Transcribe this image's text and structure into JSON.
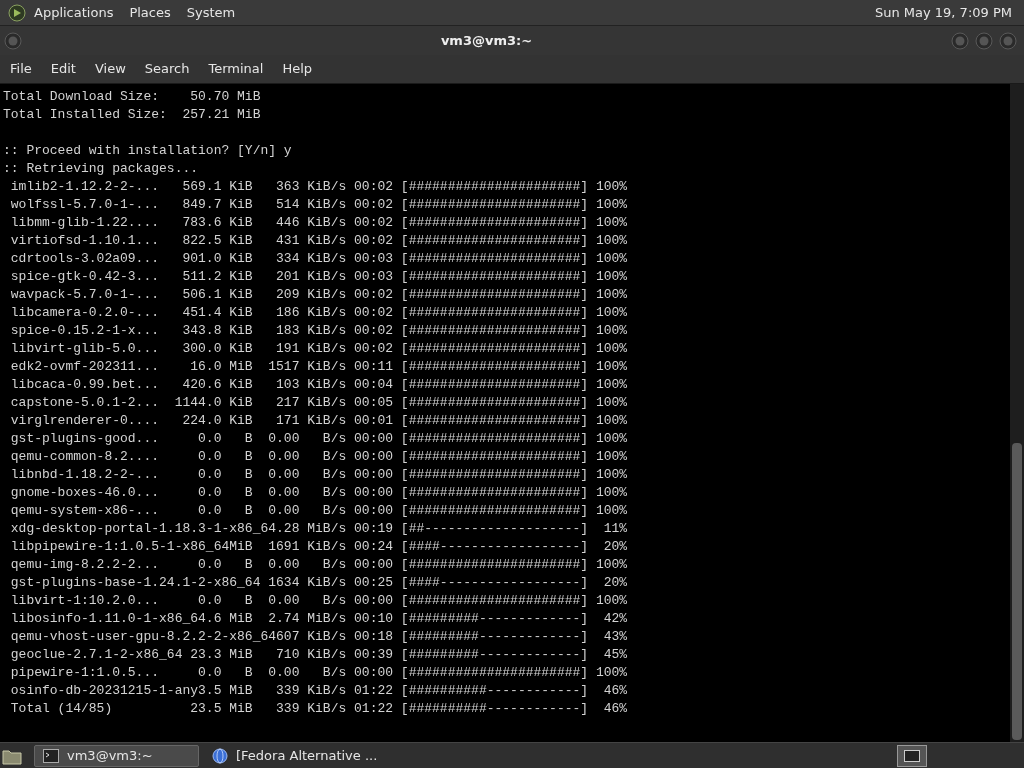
{
  "top_panel": {
    "menus": [
      "Applications",
      "Places",
      "System"
    ],
    "clock": "Sun May 19, 7:09 PM"
  },
  "window": {
    "title": "vm3@vm3:~"
  },
  "menu_bar": [
    "File",
    "Edit",
    "View",
    "Search",
    "Terminal",
    "Help"
  ],
  "terminal": {
    "blocks": [
      [
        "Total Download Size:    50.70 MiB",
        "Total Installed Size:  257.21 MiB"
      ],
      [
        ":: Proceed with installation? [Y/n] y",
        ":: Retrieving packages...",
        " imlib2-1.12.2-2-...   569.1 KiB   363 KiB/s 00:02 [######################] 100%",
        " wolfssl-5.7.0-1-...   849.7 KiB   514 KiB/s 00:02 [######################] 100%",
        " libmm-glib-1.22....   783.6 KiB   446 KiB/s 00:02 [######################] 100%",
        " virtiofsd-1.10.1...   822.5 KiB   431 KiB/s 00:02 [######################] 100%",
        " cdrtools-3.02a09...   901.0 KiB   334 KiB/s 00:03 [######################] 100%",
        " spice-gtk-0.42-3...   511.2 KiB   201 KiB/s 00:03 [######################] 100%",
        " wavpack-5.7.0-1-...   506.1 KiB   209 KiB/s 00:02 [######################] 100%",
        " libcamera-0.2.0-...   451.4 KiB   186 KiB/s 00:02 [######################] 100%",
        " spice-0.15.2-1-x...   343.8 KiB   183 KiB/s 00:02 [######################] 100%",
        " libvirt-glib-5.0...   300.0 KiB   191 KiB/s 00:02 [######################] 100%",
        " edk2-ovmf-202311...    16.0 MiB  1517 KiB/s 00:11 [######################] 100%",
        " libcaca-0.99.bet...   420.6 KiB   103 KiB/s 00:04 [######################] 100%",
        " capstone-5.0.1-2...  1144.0 KiB   217 KiB/s 00:05 [######################] 100%",
        " virglrenderer-0....   224.0 KiB   171 KiB/s 00:01 [######################] 100%",
        " gst-plugins-good...     0.0   B  0.00   B/s 00:00 [######################] 100%",
        " qemu-common-8.2....     0.0   B  0.00   B/s 00:00 [######################] 100%",
        " libnbd-1.18.2-2-...     0.0   B  0.00   B/s 00:00 [######################] 100%",
        " gnome-boxes-46.0...     0.0   B  0.00   B/s 00:00 [######################] 100%",
        " qemu-system-x86-...     0.0   B  0.00   B/s 00:00 [######################] 100%",
        " xdg-desktop-portal-1.18.3-1-x86_64.28 MiB/s 00:19 [##--------------------]  11%",
        " libpipewire-1:1.0.5-1-x86_64MiB  1691 KiB/s 00:24 [####------------------]  20%",
        " qemu-img-8.2.2-2...     0.0   B  0.00   B/s 00:00 [######################] 100%",
        " gst-plugins-base-1.24.1-2-x86_64 1634 KiB/s 00:25 [####------------------]  20%",
        " libvirt-1:10.2.0...     0.0   B  0.00   B/s 00:00 [######################] 100%",
        " libosinfo-1.11.0-1-x86_64.6 MiB  2.74 MiB/s 00:10 [#########-------------]  42%",
        " qemu-vhost-user-gpu-8.2.2-2-x86_64607 KiB/s 00:18 [#########-------------]  43%",
        " geoclue-2.7.1-2-x86_64 23.3 MiB   710 KiB/s 00:39 [#########-------------]  45%",
        " pipewire-1:1.0.5...     0.0   B  0.00   B/s 00:00 [######################] 100%",
        " osinfo-db-20231215-1-any3.5 MiB   339 KiB/s 01:22 [##########------------]  46%",
        " Total (14/85)          23.5 MiB   339 KiB/s 01:22 [##########------------]  46%"
      ]
    ]
  },
  "taskbar": {
    "tasks": [
      {
        "kind": "terminal",
        "label": "vm3@vm3:~",
        "selected": true
      },
      {
        "kind": "browser",
        "label": "[Fedora Alternative ...",
        "selected": false
      }
    ]
  }
}
